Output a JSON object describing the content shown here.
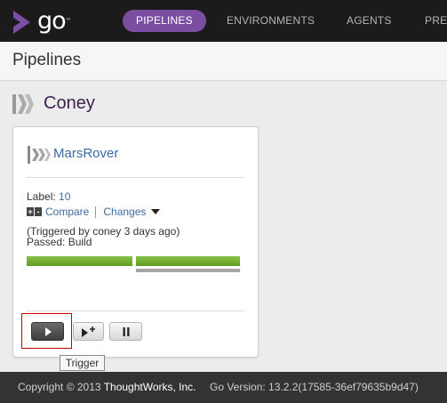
{
  "nav": {
    "logo_text": "go",
    "logo_tm": "™",
    "items": [
      "PIPELINES",
      "ENVIRONMENTS",
      "AGENTS",
      "PRE"
    ]
  },
  "page": {
    "title": "Pipelines"
  },
  "group": {
    "name": "Coney"
  },
  "pipeline": {
    "name": "MarsRover",
    "label_prefix": "Label:",
    "label_value": "10",
    "compare": "Compare",
    "changes": "Changes",
    "triggered": "(Triggered by coney 3 days ago)",
    "passed": "Passed: Build",
    "stage_status": "passed",
    "colors": {
      "passed": "#6aab2a",
      "pending": "#a6a6a6",
      "accent": "#7c4ea2",
      "link": "#3b6aa6",
      "highlight": "#cc0000"
    }
  },
  "actions": {
    "trigger_icon": "play-icon",
    "trigger_with_options_icon": "play-plus-icon",
    "pause_icon": "pause-icon"
  },
  "tooltip": {
    "text": "Trigger"
  },
  "footer": {
    "copyright_prefix": "Copyright © 2013",
    "company": "ThoughtWorks, Inc.",
    "version": "Go Version: 13.2.2(17585-36ef79635b9d47)"
  }
}
